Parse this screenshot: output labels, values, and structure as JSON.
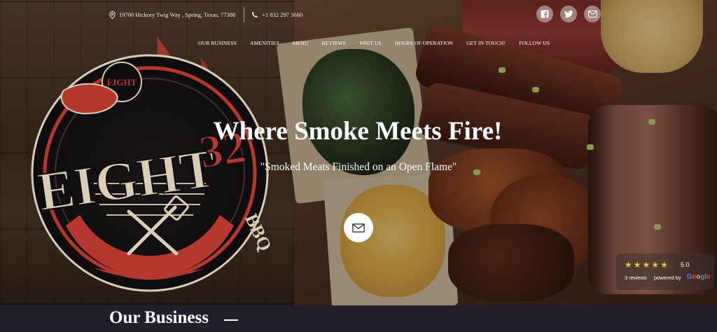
{
  "header": {
    "address": "19700 Hickory Twig Way , Spring, Texas, 77388",
    "phone": "+1 832 297 3680",
    "social": [
      {
        "name": "facebook",
        "icon": "facebook-icon"
      },
      {
        "name": "twitter",
        "icon": "twitter-icon"
      },
      {
        "name": "email",
        "icon": "envelope-icon"
      }
    ]
  },
  "nav": {
    "items": [
      {
        "label": "OUR BUSINESS"
      },
      {
        "label": "AMENITIES"
      },
      {
        "label": "MENU"
      },
      {
        "label": "REVIEWS"
      },
      {
        "label": "VISIT US"
      },
      {
        "label": "HOURS OF OPERATION"
      },
      {
        "label": "GET IN TOUCH!"
      },
      {
        "label": "FOLLOW US"
      }
    ]
  },
  "logo": {
    "top_text": "EIGHT",
    "main_text": "EIGHT",
    "number": "32",
    "sub_text": "BBQ"
  },
  "hero": {
    "headline": "Where Smoke Meets Fire!",
    "subheadline": "\"Smoked Meats Finished on an Open Flame\"",
    "cta_icon": "envelope-icon"
  },
  "reviews_widget": {
    "stars": 5,
    "rating": "5.0",
    "count_text": "3 reviews",
    "powered_by": "powered by",
    "provider": "Google"
  },
  "section": {
    "title": "Our Business"
  },
  "colors": {
    "section_background": "#211f2c",
    "star": "#f0c43a",
    "logo_red": "#b5372e",
    "logo_cream": "#d8cdb5"
  }
}
